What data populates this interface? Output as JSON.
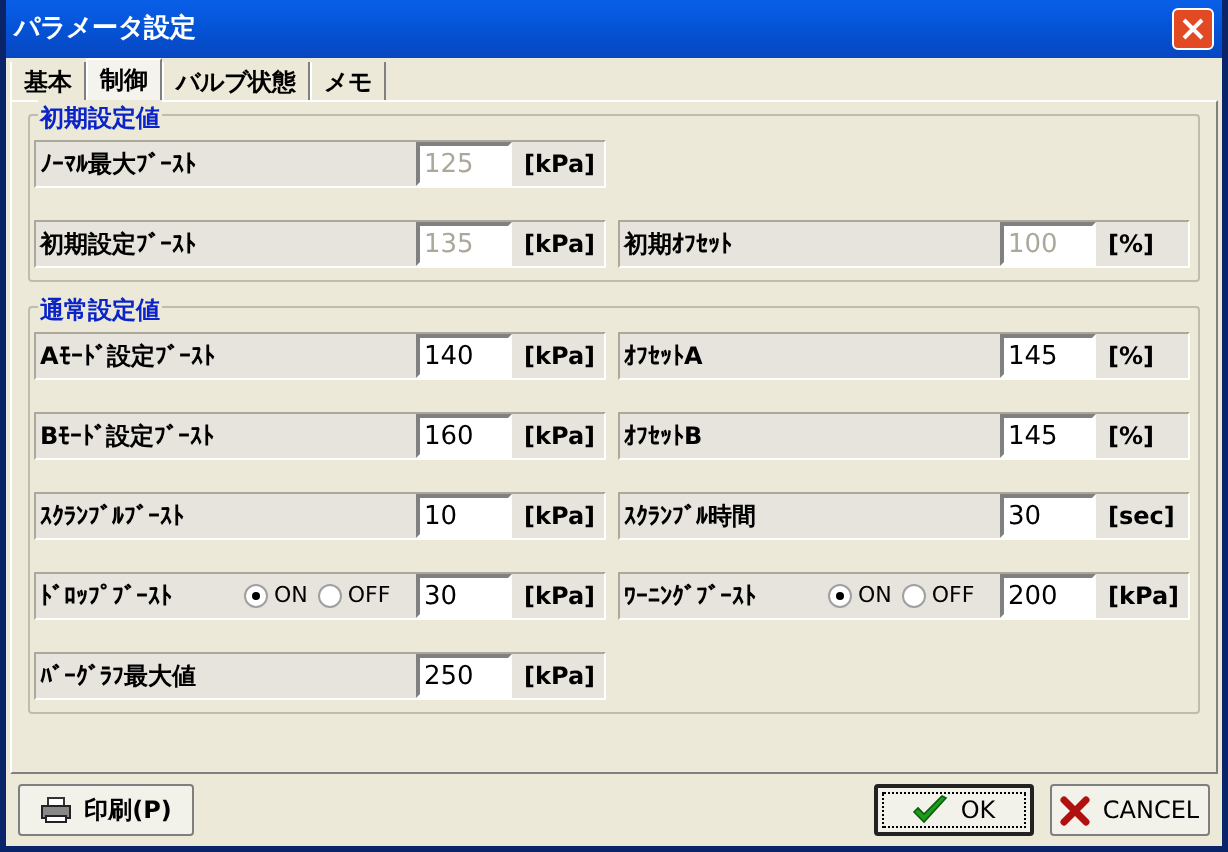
{
  "window": {
    "title": "パラメータ設定"
  },
  "tabs": [
    {
      "label": "基本",
      "selected": false
    },
    {
      "label": "制御",
      "selected": true
    },
    {
      "label": "バルブ状態",
      "selected": false
    },
    {
      "label": "メモ",
      "selected": false
    }
  ],
  "groups": [
    {
      "title": "初期設定値",
      "rows": [
        {
          "cells": [
            {
              "label": "ﾉｰﾏﾙ最大ﾌﾞｰｽﾄ",
              "value": "125",
              "unit": "[kPa]",
              "disabled": true
            }
          ]
        },
        {
          "cells": [
            {
              "label": "初期設定ﾌﾞｰｽﾄ",
              "value": "135",
              "unit": "[kPa]",
              "disabled": true
            },
            {
              "label": "初期ｵﾌｾｯﾄ",
              "value": "100",
              "unit": "[%]",
              "disabled": true
            }
          ]
        }
      ]
    },
    {
      "title": "通常設定値",
      "rows": [
        {
          "cells": [
            {
              "label": "Aﾓｰﾄﾞ設定ﾌﾞｰｽﾄ",
              "value": "140",
              "unit": "[kPa]",
              "disabled": false
            },
            {
              "label": "ｵﾌｾｯﾄA",
              "value": "145",
              "unit": "[%]",
              "disabled": false
            }
          ]
        },
        {
          "cells": [
            {
              "label": "Bﾓｰﾄﾞ設定ﾌﾞｰｽﾄ",
              "value": "160",
              "unit": "[kPa]",
              "disabled": false
            },
            {
              "label": "ｵﾌｾｯﾄB",
              "value": "145",
              "unit": "[%]",
              "disabled": false
            }
          ]
        },
        {
          "cells": [
            {
              "label": "ｽｸﾗﾝﾌﾞﾙﾌﾞｰｽﾄ",
              "value": "10",
              "unit": "[kPa]",
              "disabled": false
            },
            {
              "label": "ｽｸﾗﾝﾌﾞﾙ時間",
              "value": "30",
              "unit": "[sec]",
              "disabled": false
            }
          ]
        },
        {
          "cells": [
            {
              "label": "ﾄﾞﾛｯﾌﾟﾌﾞｰｽﾄ",
              "value": "30",
              "unit": "[kPa]",
              "disabled": false,
              "radios": [
                {
                  "label": "ON",
                  "selected": true
                },
                {
                  "label": "OFF",
                  "selected": false
                }
              ]
            },
            {
              "label": "ﾜｰﾆﾝｸﾞﾌﾞｰｽﾄ",
              "value": "200",
              "unit": "[kPa]",
              "disabled": false,
              "radios": [
                {
                  "label": "ON",
                  "selected": true
                },
                {
                  "label": "OFF",
                  "selected": false
                }
              ]
            }
          ]
        },
        {
          "cells": [
            {
              "label": "ﾊﾞｰｸﾞﾗﾌ最大値",
              "value": "250",
              "unit": "[kPa]",
              "disabled": false
            }
          ]
        }
      ]
    }
  ],
  "buttons": [
    {
      "kind": "print",
      "label": "印刷(P)",
      "focused": false
    },
    {
      "kind": "ok",
      "label": "OK",
      "focused": true
    },
    {
      "kind": "cancel",
      "label": "CANCEL",
      "focused": false
    }
  ]
}
